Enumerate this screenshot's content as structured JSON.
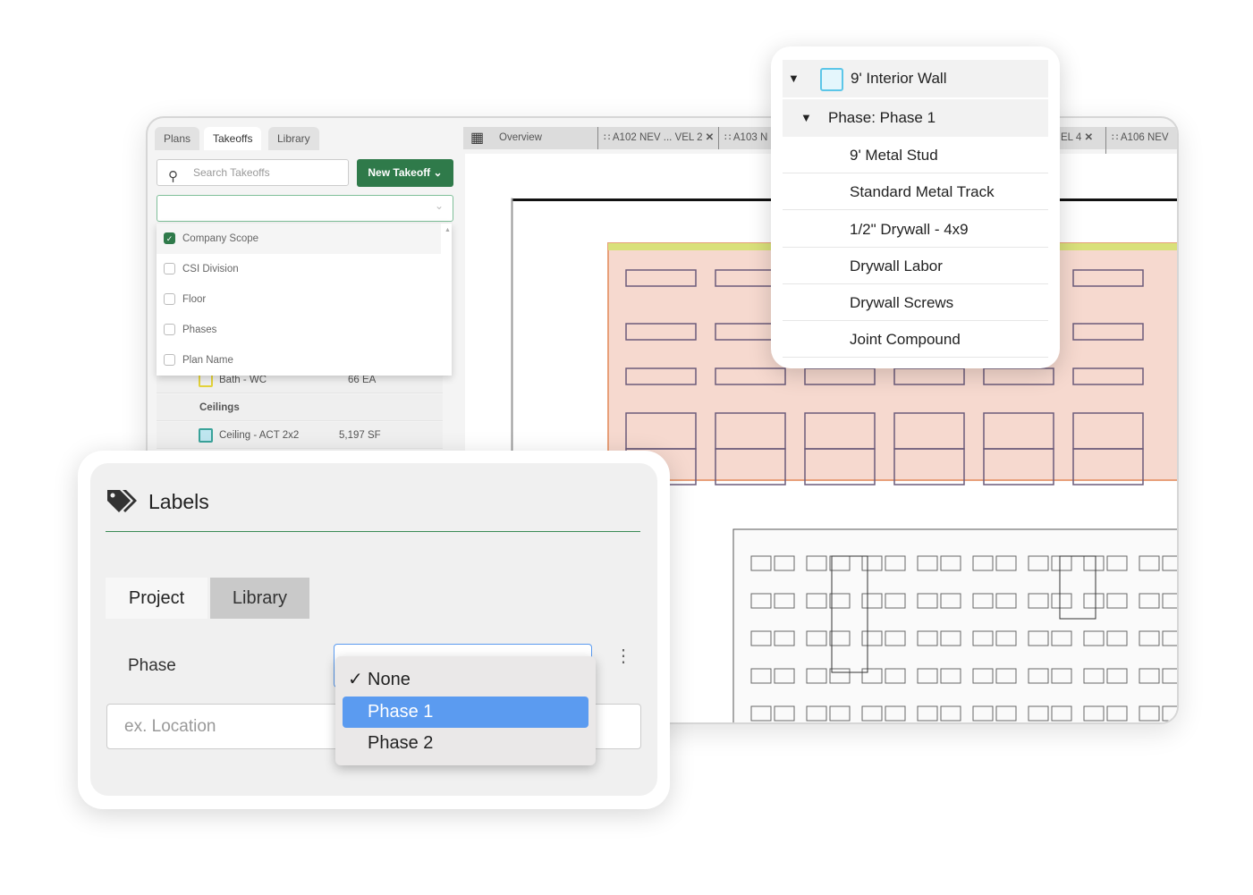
{
  "left_panel": {
    "tabs": [
      {
        "label": "Plans"
      },
      {
        "label": "Takeoffs",
        "active": true
      },
      {
        "label": "Library"
      }
    ],
    "search_placeholder": "Search Takeoffs",
    "new_takeoff_label": "New Takeoff",
    "group_options": [
      {
        "label": "Company Scope",
        "checked": true
      },
      {
        "label": "CSI Division",
        "checked": false
      },
      {
        "label": "Floor",
        "checked": false
      },
      {
        "label": "Phases",
        "checked": false
      },
      {
        "label": "Plan Name",
        "checked": false
      }
    ],
    "rows": [
      {
        "name": "Bath - WC",
        "qty": "66 EA"
      },
      {
        "group": "Ceilings"
      },
      {
        "name": "Ceiling - ACT 2x2",
        "qty": "5,197 SF"
      }
    ]
  },
  "plan_tabs": [
    {
      "label": "Overview"
    },
    {
      "label": "A102 NEV ... VEL 2"
    },
    {
      "label": "A103 N"
    },
    {
      "label": "EL 4"
    },
    {
      "label": "A106 NEV ..."
    }
  ],
  "takeoff_popup": {
    "title": "9' Interior Wall",
    "phase": "Phase: Phase 1",
    "items": [
      "9' Metal Stud",
      "Standard Metal Track",
      "1/2\" Drywall - 4x9",
      "Drywall Labor",
      "Drywall Screws",
      "Joint Compound"
    ]
  },
  "labels_panel": {
    "title": "Labels",
    "tabs": [
      {
        "label": "Project",
        "active": true
      },
      {
        "label": "Library"
      }
    ],
    "phase_label": "Phase",
    "location_placeholder": "ex. Location",
    "phase_options": [
      {
        "label": "None",
        "checked": true
      },
      {
        "label": "Phase 1",
        "highlighted": true
      },
      {
        "label": "Phase 2"
      }
    ]
  },
  "colors": {
    "brand_green": "#2f7a4a",
    "highlight_blue": "#5b9bf0",
    "facade": "#f6d9cf"
  }
}
